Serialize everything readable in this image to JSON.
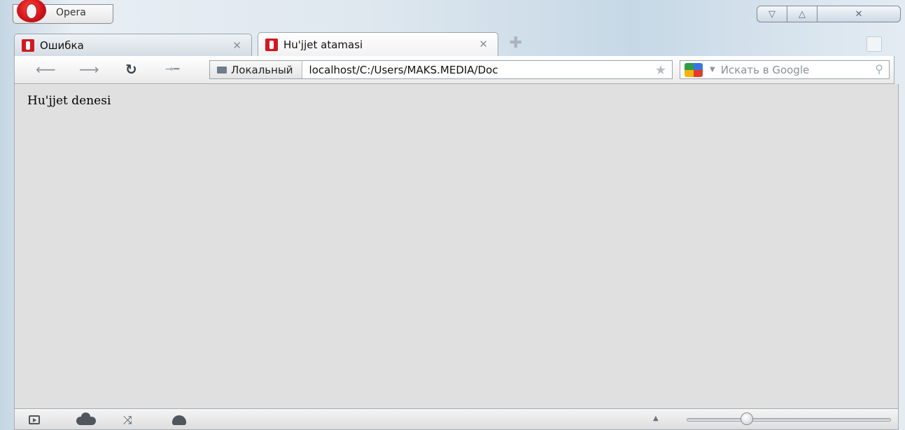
{
  "window": {
    "app_button_label": "Opera"
  },
  "tabs": [
    {
      "title": "Ошибка",
      "active": false
    },
    {
      "title": "Hu'jjet atamasi",
      "active": true
    }
  ],
  "toolbar": {
    "address_badge": "Локальный",
    "address_value": "localhost/C:/Users/MAKS.MEDIA/Doc",
    "search_placeholder": "Искать в Google"
  },
  "content": {
    "body_text": "Hu'jjet denesi"
  },
  "statusbar": {
    "zoom_level": 0.28
  },
  "icons": {
    "back": "arrow-left-icon",
    "forward": "arrow-right-icon",
    "reload": "reload-icon",
    "wand": "key-icon",
    "tab_close": "close-icon",
    "new_tab": "plus-icon",
    "trash": "trash-icon",
    "bookmark": "star-icon",
    "search": "magnifier-icon"
  },
  "colors": {
    "opera_red": "#d01a1f",
    "content_bg": "#e0e0e0"
  }
}
